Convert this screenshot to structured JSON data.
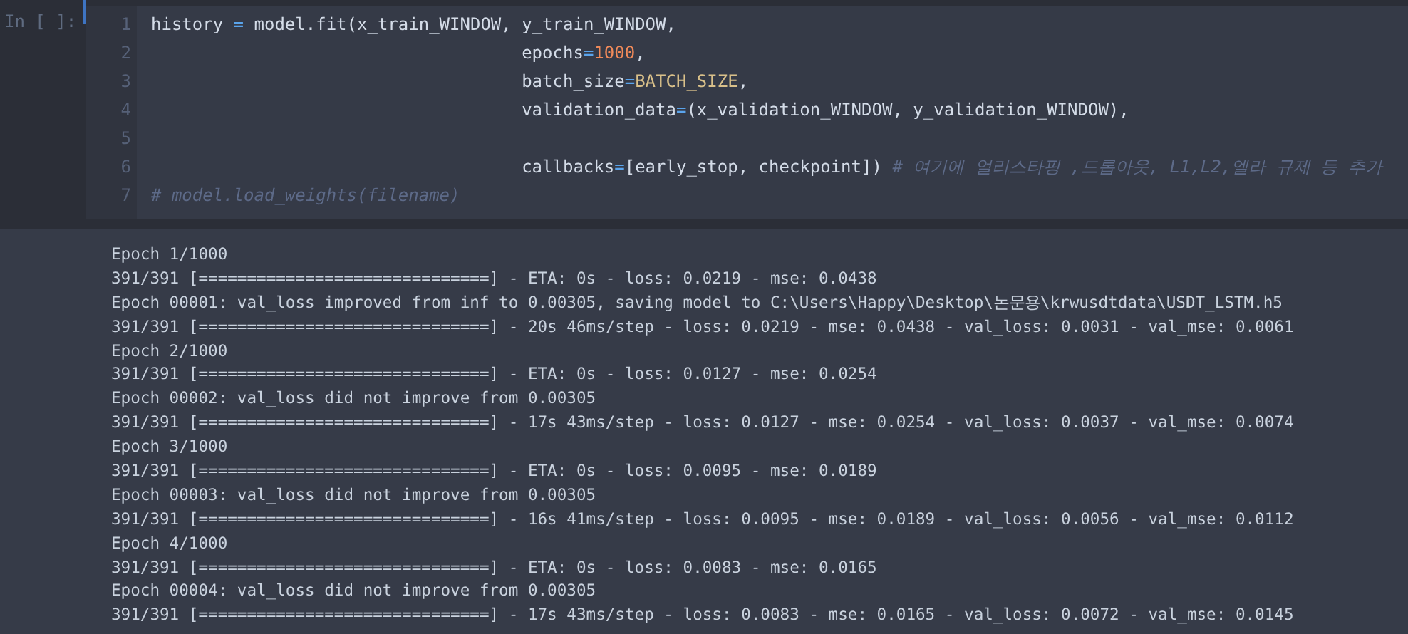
{
  "cell": {
    "prompt": "In [ ]:",
    "lines": [
      {
        "number": "1",
        "tokens": [
          {
            "kind": "plain",
            "text": "history "
          },
          {
            "kind": "operator",
            "text": "="
          },
          {
            "kind": "plain",
            "text": " model.fit(x_train_WINDOW, y_train_WINDOW,"
          }
        ]
      },
      {
        "number": "2",
        "tokens": [
          {
            "kind": "plain",
            "text": "                                    epochs"
          },
          {
            "kind": "operator",
            "text": "="
          },
          {
            "kind": "number",
            "text": "1000"
          },
          {
            "kind": "plain",
            "text": ","
          }
        ]
      },
      {
        "number": "3",
        "tokens": [
          {
            "kind": "plain",
            "text": "                                    batch_size"
          },
          {
            "kind": "operator",
            "text": "="
          },
          {
            "kind": "constant",
            "text": "BATCH_SIZE"
          },
          {
            "kind": "plain",
            "text": ","
          }
        ]
      },
      {
        "number": "4",
        "tokens": [
          {
            "kind": "plain",
            "text": "                                    validation_data"
          },
          {
            "kind": "operator",
            "text": "="
          },
          {
            "kind": "plain",
            "text": "(x_validation_WINDOW, y_validation_WINDOW),"
          }
        ]
      },
      {
        "number": "5"
      },
      {
        "number": "6",
        "tokens": [
          {
            "kind": "plain",
            "text": "                                    callbacks"
          },
          {
            "kind": "operator",
            "text": "="
          },
          {
            "kind": "plain",
            "text": "[early_stop, checkpoint]) "
          },
          {
            "kind": "comment",
            "text": "# 여기에 얼리스타핑 ,드롭아웃, L1,L2,엘라 규제 등 추가"
          }
        ]
      },
      {
        "number": "7",
        "tokens": [
          {
            "kind": "comment",
            "text": "# model.load_weights(filename)"
          }
        ]
      }
    ]
  },
  "output": [
    "Epoch 1/1000",
    "391/391 [==============================] - ETA: 0s - loss: 0.0219 - mse: 0.0438",
    "Epoch 00001: val_loss improved from inf to 0.00305, saving model to C:\\Users\\Happy\\Desktop\\논문용\\krwusdtdata\\USDT_LSTM.h5",
    "391/391 [==============================] - 20s 46ms/step - loss: 0.0219 - mse: 0.0438 - val_loss: 0.0031 - val_mse: 0.0061",
    "Epoch 2/1000",
    "391/391 [==============================] - ETA: 0s - loss: 0.0127 - mse: 0.0254",
    "Epoch 00002: val_loss did not improve from 0.00305",
    "391/391 [==============================] - 17s 43ms/step - loss: 0.0127 - mse: 0.0254 - val_loss: 0.0037 - val_mse: 0.0074",
    "Epoch 3/1000",
    "391/391 [==============================] - ETA: 0s - loss: 0.0095 - mse: 0.0189",
    "Epoch 00003: val_loss did not improve from 0.00305",
    "391/391 [==============================] - 16s 41ms/step - loss: 0.0095 - mse: 0.0189 - val_loss: 0.0056 - val_mse: 0.0112",
    "Epoch 4/1000",
    "391/391 [==============================] - ETA: 0s - loss: 0.0083 - mse: 0.0165",
    "Epoch 00004: val_loss did not improve from 0.00305",
    "391/391 [==============================] - 17s 43ms/step - loss: 0.0083 - mse: 0.0165 - val_loss: 0.0072 - val_mse: 0.0145"
  ]
}
